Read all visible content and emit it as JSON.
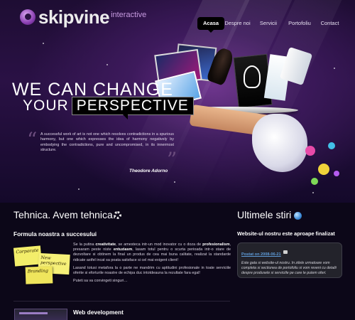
{
  "header": {
    "logo_text": "skipvine",
    "logo_sub": "interactive",
    "nav": [
      {
        "label": "Acasa",
        "active": true
      },
      {
        "label": "Despre noi",
        "active": false
      },
      {
        "label": "Servicii",
        "active": false
      },
      {
        "label": "Portofoliu",
        "active": false
      },
      {
        "label": "Contact",
        "active": false
      }
    ]
  },
  "hero": {
    "headline_line1": "WE CAN CHANGE",
    "headline_line2_plain": "YOUR",
    "headline_line2_highlight": "PERSPECTIVE",
    "quote": "A successful work of art is not one which resolves contradictions in a spurious harmony, but one which expresses the idea of harmony negatively by embodying the contradictions, pure and uncompromised, in its innermost structure.",
    "author": "Theodore Adorno"
  },
  "tehnica": {
    "title": "Tehnica. Avem tehnica.",
    "subtitle": "Formula noastra a succesului",
    "postits": [
      "Corporate",
      "New perspective",
      "Branding"
    ],
    "p1_a": "Se la putina ",
    "p1_b": "creativitate",
    "p1_c": ", se amesteca intr-un mod inovator cu o doza de ",
    "p1_d": "profesionalism",
    "p1_e": ", presaram peste niste ",
    "p1_f": "entuziasm",
    "p1_g": ", lasam totul pentru o scurta perioada intr-o stare de dezvoltare si obtinem la final un produs de cea mai buna calitate, realizat la standarde ridicate astfel incat sa poata satisface si cel mai exigent client!",
    "p2": "Lasand totusi metafora la o parte ne mandrim cu aptitudini profesionale in toate serviciile oferite si eforturile noastre de echipa duc intotdeauna la rezultate fara egal!",
    "link": "Puteti sa va convingeti singuri…",
    "web_dev": "Web development"
  },
  "news": {
    "title": "Ultimele stiri",
    "item_title": "Website-ul nostru este aproape finalizat",
    "date": "Postat on 2008-06-21",
    "text": "Este gata si website-ul nostru. In zilele urmatoare vom completa si sectiunea de portofoliu si vom reveni cu detalii despre produsele si serviciile pe care le putem oferi."
  },
  "colors": {
    "background": "#0c0718",
    "accent_purple": "#8a3fb2",
    "link_blue": "#5e9bd8",
    "postit_yellow": "#f3ee6a"
  }
}
